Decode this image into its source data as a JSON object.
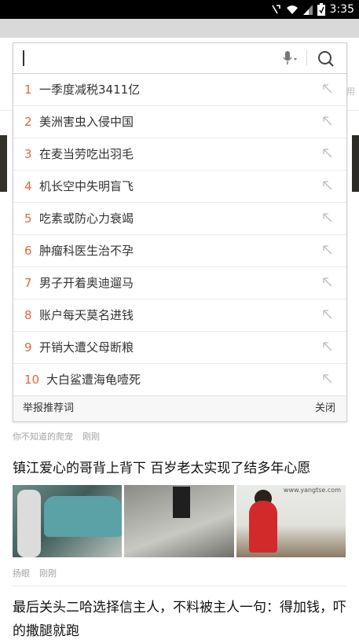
{
  "status_bar": {
    "time": "3:35"
  },
  "background": {
    "right_snippet": "用"
  },
  "search": {
    "mic_icon": "mic-icon",
    "search_icon": "search-icon",
    "suggestions": [
      {
        "rank": "1",
        "text": "一季度减税3411亿"
      },
      {
        "rank": "2",
        "text": "美洲害虫入侵中国"
      },
      {
        "rank": "3",
        "text": "在麦当劳吃出羽毛"
      },
      {
        "rank": "4",
        "text": "机长空中失明盲飞"
      },
      {
        "rank": "5",
        "text": "吃素或防心力衰竭"
      },
      {
        "rank": "6",
        "text": "肿瘤科医生治不孕"
      },
      {
        "rank": "7",
        "text": "男子开着奥迪遛马"
      },
      {
        "rank": "8",
        "text": "账户每天莫名进钱"
      },
      {
        "rank": "9",
        "text": "开销大遭父母断粮"
      },
      {
        "rank": "10",
        "text": "大白鲨遭海龟噎死"
      }
    ],
    "report_label": "举报推荐词",
    "close_label": "关闭"
  },
  "feed": {
    "item1": {
      "source": "你不知道的爬宠",
      "time": "刚刚"
    },
    "item2": {
      "title": "镇江爱心的哥背上背下 百岁老太实现了结多年心愿",
      "photo_watermark": "www.yangtse.com",
      "source": "扬眼",
      "time": "刚刚"
    },
    "item3": {
      "title": "最后关头二哈选择信主人，不料被主人一句：得加钱，吓的撒腿就跑"
    }
  }
}
